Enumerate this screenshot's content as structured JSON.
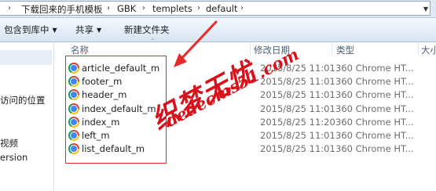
{
  "address_bar": {
    "crumbs": [
      "下载回来的手机模板",
      "GBK",
      "templets",
      "default"
    ]
  },
  "toolbar": {
    "include_in_library": "包含到库中",
    "share": "共享",
    "new_folder": "新建文件夹"
  },
  "nav_pane": {
    "items": [
      "访问的位置",
      "视频",
      "ersion"
    ]
  },
  "columns": {
    "name": "名称",
    "date_modified": "修改日期",
    "type": "类型",
    "size": "大小"
  },
  "files": [
    {
      "name": "article_default_m",
      "date": "2015/8/25 11:01",
      "type": "360 Chrome HT..."
    },
    {
      "name": "footer_m",
      "date": "2015/8/25 11:01",
      "type": "360 Chrome HT..."
    },
    {
      "name": "header_m",
      "date": "2015/8/25 11:01",
      "type": "360 Chrome HT..."
    },
    {
      "name": "index_default_m",
      "date": "2015/8/25 11:01",
      "type": "360 Chrome HT..."
    },
    {
      "name": "index_m",
      "date": "2015/8/25 11:20",
      "type": "360 Chrome HT..."
    },
    {
      "name": "left_m",
      "date": "2015/8/25 11:01",
      "type": "360 Chrome HT..."
    },
    {
      "name": "list_default_m",
      "date": "2015/8/25 11:01",
      "type": "360 Chrome HT..."
    }
  ],
  "file_icon": "chrome-html-icon",
  "watermark": {
    "chinese": "织梦无忧",
    "url": "dedecms51.com",
    "color": "#d8121d"
  },
  "annotation_color": "#e8292a"
}
